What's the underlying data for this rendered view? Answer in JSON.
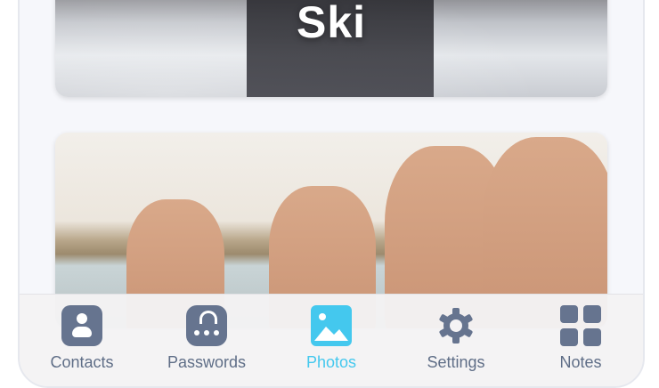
{
  "cards": [
    {
      "title": "Ski"
    },
    {
      "title": ""
    }
  ],
  "tabbar": {
    "tabs": [
      {
        "label": "Contacts",
        "icon": "contacts-icon",
        "active": false
      },
      {
        "label": "Passwords",
        "icon": "lock-icon",
        "active": false
      },
      {
        "label": "Photos",
        "icon": "photos-icon",
        "active": true
      },
      {
        "label": "Settings",
        "icon": "gear-icon",
        "active": false
      },
      {
        "label": "Notes",
        "icon": "grid-icon",
        "active": false
      }
    ]
  },
  "colors": {
    "accent": "#44c8ee",
    "inactive": "#66748f"
  }
}
